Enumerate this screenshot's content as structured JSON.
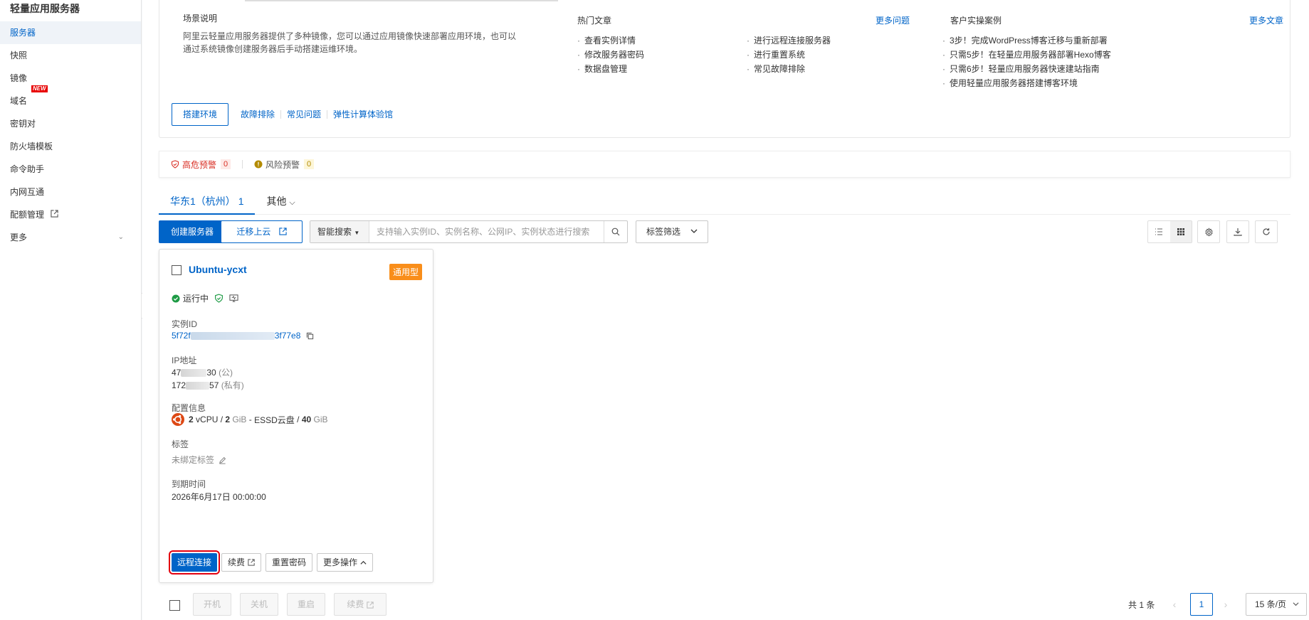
{
  "app": {
    "title": "轻量应用服务器"
  },
  "sidebar": {
    "items": [
      {
        "label": "服务器"
      },
      {
        "label": "快照"
      },
      {
        "label": "镜像"
      },
      {
        "label": "域名",
        "badge": "NEW"
      },
      {
        "label": "密钥对"
      },
      {
        "label": "防火墙模板"
      },
      {
        "label": "命令助手"
      },
      {
        "label": "内网互通"
      },
      {
        "label": "配额管理"
      },
      {
        "label": "更多"
      }
    ]
  },
  "intro": {
    "scene": {
      "title": "场景说明",
      "desc": "阿里云轻量应用服务器提供了多种镜像，您可以通过应用镜像快速部署应用环境，也可以通过系统镜像创建服务器后手动搭建运维环境。"
    },
    "hot": {
      "title": "热门文章",
      "more": "更多问题",
      "col1": [
        "查看实例详情",
        "修改服务器密码",
        "数据盘管理"
      ],
      "col2": [
        "进行远程连接服务器",
        "进行重置系统",
        "常见故障排除"
      ]
    },
    "cases": {
      "title": "客户实操案例",
      "more": "更多文章",
      "items": [
        "3步！完成WordPress博客迁移与重新部署",
        "只需5步！在轻量应用服务器部署Hexo博客",
        "只需6步！轻量应用服务器快速建站指南",
        "使用轻量应用服务器搭建博客环境"
      ]
    },
    "actions": {
      "primary": "搭建环境",
      "links": [
        "故障排除",
        "常见问题",
        "弹性计算体验馆"
      ]
    }
  },
  "alerts": {
    "high": {
      "label": "高危预警",
      "count": "0",
      "color": "#d93026"
    },
    "risk": {
      "label": "风险预警",
      "count": "0",
      "color": "#c89a00"
    }
  },
  "tabs": [
    {
      "label": "华东1（杭州）",
      "count": "1"
    },
    {
      "label": "其他"
    }
  ],
  "toolbar": {
    "create": "创建服务器",
    "migrate": "迁移上云",
    "search_mode": "智能搜索",
    "search_placeholder": "支持输入实例ID、实例名称、公网IP、实例状态进行搜索",
    "tag_filter": "标签筛选"
  },
  "card": {
    "name": "Ubuntu-ycxt",
    "type_tag": "通用型",
    "status": "运行中",
    "instance_id_label": "实例ID",
    "instance_id_prefix": "5f72f",
    "instance_id_suffix": "3f77e8",
    "ip_label": "IP地址",
    "ip_public_prefix": "47",
    "ip_public_suffix": "30",
    "ip_public_note": "(公)",
    "ip_private_prefix": "172",
    "ip_private_suffix": "57",
    "ip_private_note": "(私有)",
    "config_label": "配置信息",
    "cpu_num": "2",
    "cpu_unit": "vCPU",
    "mem_num": "2",
    "mem_unit": "GiB",
    "disk_type": "ESSD云盘",
    "disk_num": "40",
    "disk_unit": "GiB",
    "tags_label": "标签",
    "tags_value": "未绑定标签",
    "expire_label": "到期时间",
    "expire_value": "2026年6月17日 00:00:00",
    "actions": {
      "remote": "远程连接",
      "renew": "续费",
      "reset_pwd": "重置密码",
      "more": "更多操作"
    }
  },
  "footer": {
    "batch": [
      "开机",
      "关机",
      "重启",
      "续费"
    ],
    "total": "共 1 条",
    "page": "1",
    "page_size": "15 条/页"
  },
  "colors": {
    "accent": "#0064c8",
    "tag": "#f98e1a",
    "highlight": "#e3000f",
    "ok": "#1e9b45"
  }
}
